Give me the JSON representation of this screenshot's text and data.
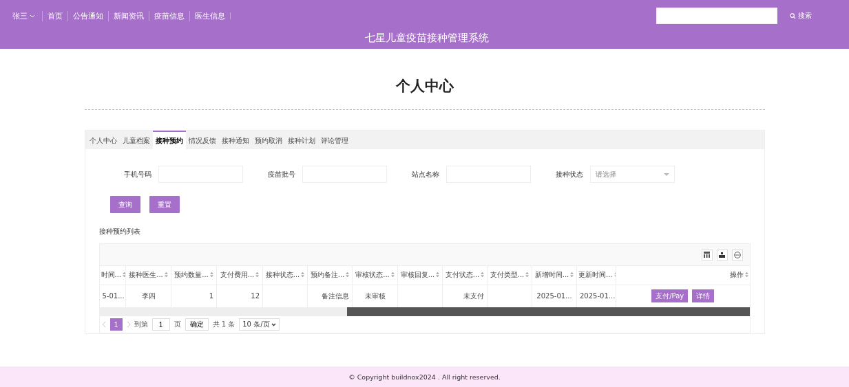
{
  "header": {
    "user": "张三",
    "nav": [
      {
        "label": "首页"
      },
      {
        "label": "公告通知"
      },
      {
        "label": "新闻资讯"
      },
      {
        "label": "疫苗信息"
      },
      {
        "label": "医生信息"
      }
    ],
    "search_button": "搜索",
    "site_title": "七星儿童疫苗接种管理系统"
  },
  "page_title": "个人中心",
  "tabs": [
    {
      "label": "个人中心",
      "selected": false
    },
    {
      "label": "儿童档案",
      "selected": false
    },
    {
      "label": "接种预约",
      "selected": true
    },
    {
      "label": "情况反馈",
      "selected": false
    },
    {
      "label": "接种通知",
      "selected": false
    },
    {
      "label": "预约取消",
      "selected": false
    },
    {
      "label": "接种计划",
      "selected": false
    },
    {
      "label": "评论管理",
      "selected": false
    }
  ],
  "filters": [
    {
      "kind": "input",
      "label": "手机号码"
    },
    {
      "kind": "input",
      "label": "疫苗批号"
    },
    {
      "kind": "input",
      "label": "站点名称"
    },
    {
      "kind": "select",
      "label": "接种状态",
      "placeholder": "请选择"
    }
  ],
  "filter_buttons": [
    "查询",
    "重置"
  ],
  "list_title": "接种预约列表",
  "table": {
    "columns": [
      {
        "label": "时间..."
      },
      {
        "label": "接种医生..."
      },
      {
        "label": "预约数量..."
      },
      {
        "label": "支付费用..."
      },
      {
        "label": "接种状态..."
      },
      {
        "label": "预约备注..."
      },
      {
        "label": "审核状态..."
      },
      {
        "label": "审核回复..."
      },
      {
        "label": "支付状态..."
      },
      {
        "label": "支付类型..."
      },
      {
        "label": "新增时间..."
      },
      {
        "label": "更新时间..."
      }
    ],
    "action_column": "操作",
    "rows": [
      {
        "cells": [
          "5-01...",
          "李四",
          "1",
          "12",
          "",
          "备注信息",
          "未审核",
          "",
          "未支付",
          "",
          "2025-01...",
          "2025-01..."
        ],
        "actions": [
          "支付/Pay",
          "详情"
        ]
      }
    ]
  },
  "pagination": {
    "pages": [
      {
        "label": "1",
        "selected": true
      }
    ],
    "goto_label": "到第",
    "goto_value": "1",
    "page_unit": "页",
    "confirm": "确定",
    "total": "共 1 条",
    "page_size": "10 条/页"
  },
  "footer": "© Copyright buildnox2024 . All right reserved."
}
